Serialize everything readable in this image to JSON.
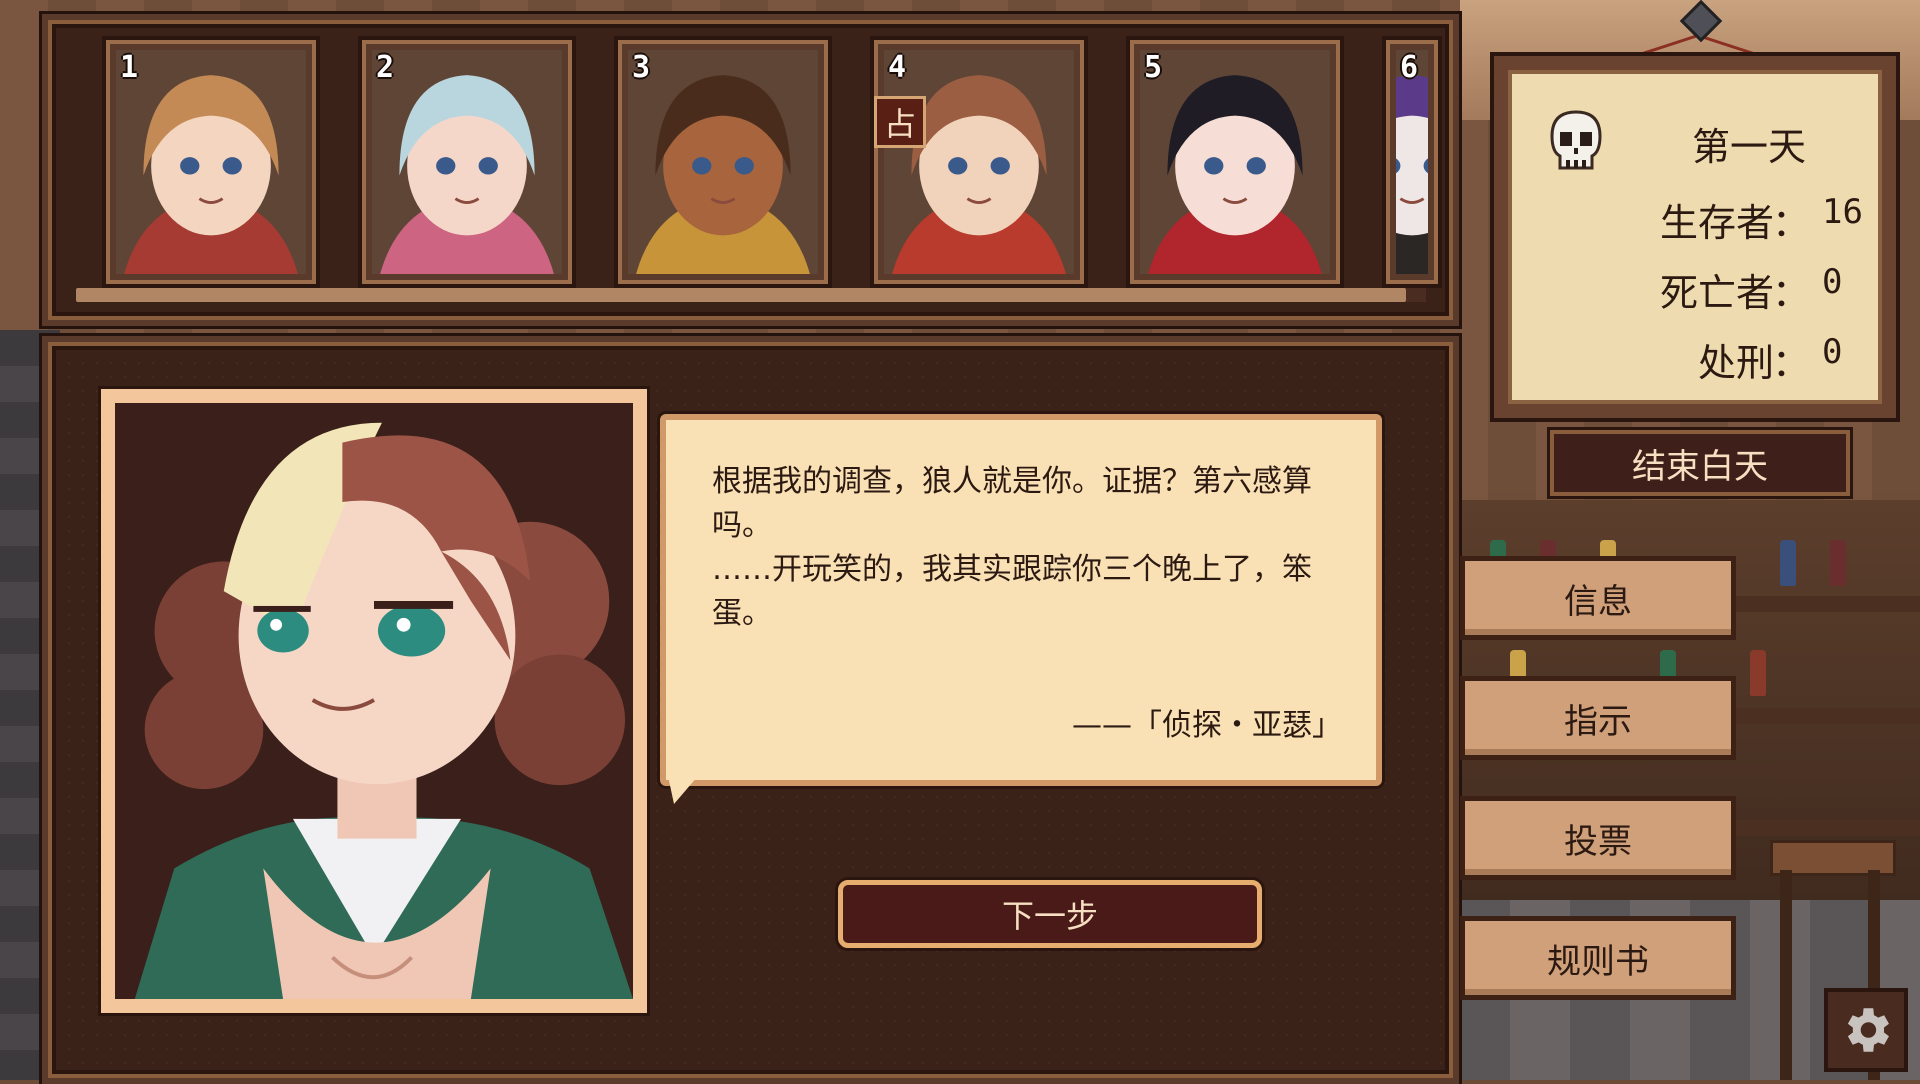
{
  "characters": [
    {
      "number": "1",
      "hair": "#c48a55",
      "skin": "#f3d5c0",
      "accent": "#b23a32"
    },
    {
      "number": "2",
      "hair": "#b9d6df",
      "skin": "#f4d7c9",
      "accent": "#e06a8e"
    },
    {
      "number": "3",
      "hair": "#4a2c1c",
      "skin": "#a7643d",
      "accent": "#d9a23a"
    },
    {
      "number": "4",
      "hair": "#9b5e43",
      "skin": "#f1d2bb",
      "accent": "#c83a2c",
      "badge": "占"
    },
    {
      "number": "5",
      "hair": "#1f1c25",
      "skin": "#f6ddd6",
      "accent": "#c0202a"
    },
    {
      "number": "6",
      "hair": "#5b3a8a",
      "skin": "#efe6e6",
      "accent": "#222222"
    }
  ],
  "dialogue": {
    "text": "根据我的调查，狼人就是你。证据？第六感算吗。\n……开玩笑的，我其实跟踪你三个晚上了，笨蛋。",
    "signature": "——「侦探・亚瑟」"
  },
  "next_button": {
    "label": "下一步"
  },
  "status": {
    "day": "第一天",
    "survivors_label": "生存者",
    "survivors": "16",
    "dead_label": "死亡者",
    "dead": "0",
    "executed_label": "处刑",
    "executed": "0",
    "colon": "："
  },
  "end_day_button": {
    "label": "结束白天"
  },
  "menu": [
    {
      "key": "info",
      "label": "信息"
    },
    {
      "key": "instructions",
      "label": "指示"
    },
    {
      "key": "vote",
      "label": "投票"
    },
    {
      "key": "rulebook",
      "label": "规则书"
    }
  ],
  "colors": {
    "panel": "#3b2219",
    "frame": "#8a5d3c",
    "bubble": "#f9e1b5",
    "menu_button": "#cfa079",
    "board": "#eedcb0"
  },
  "icons": {
    "status": "skull-icon",
    "settings": "gear-icon",
    "role_badge": "seer-badge"
  }
}
